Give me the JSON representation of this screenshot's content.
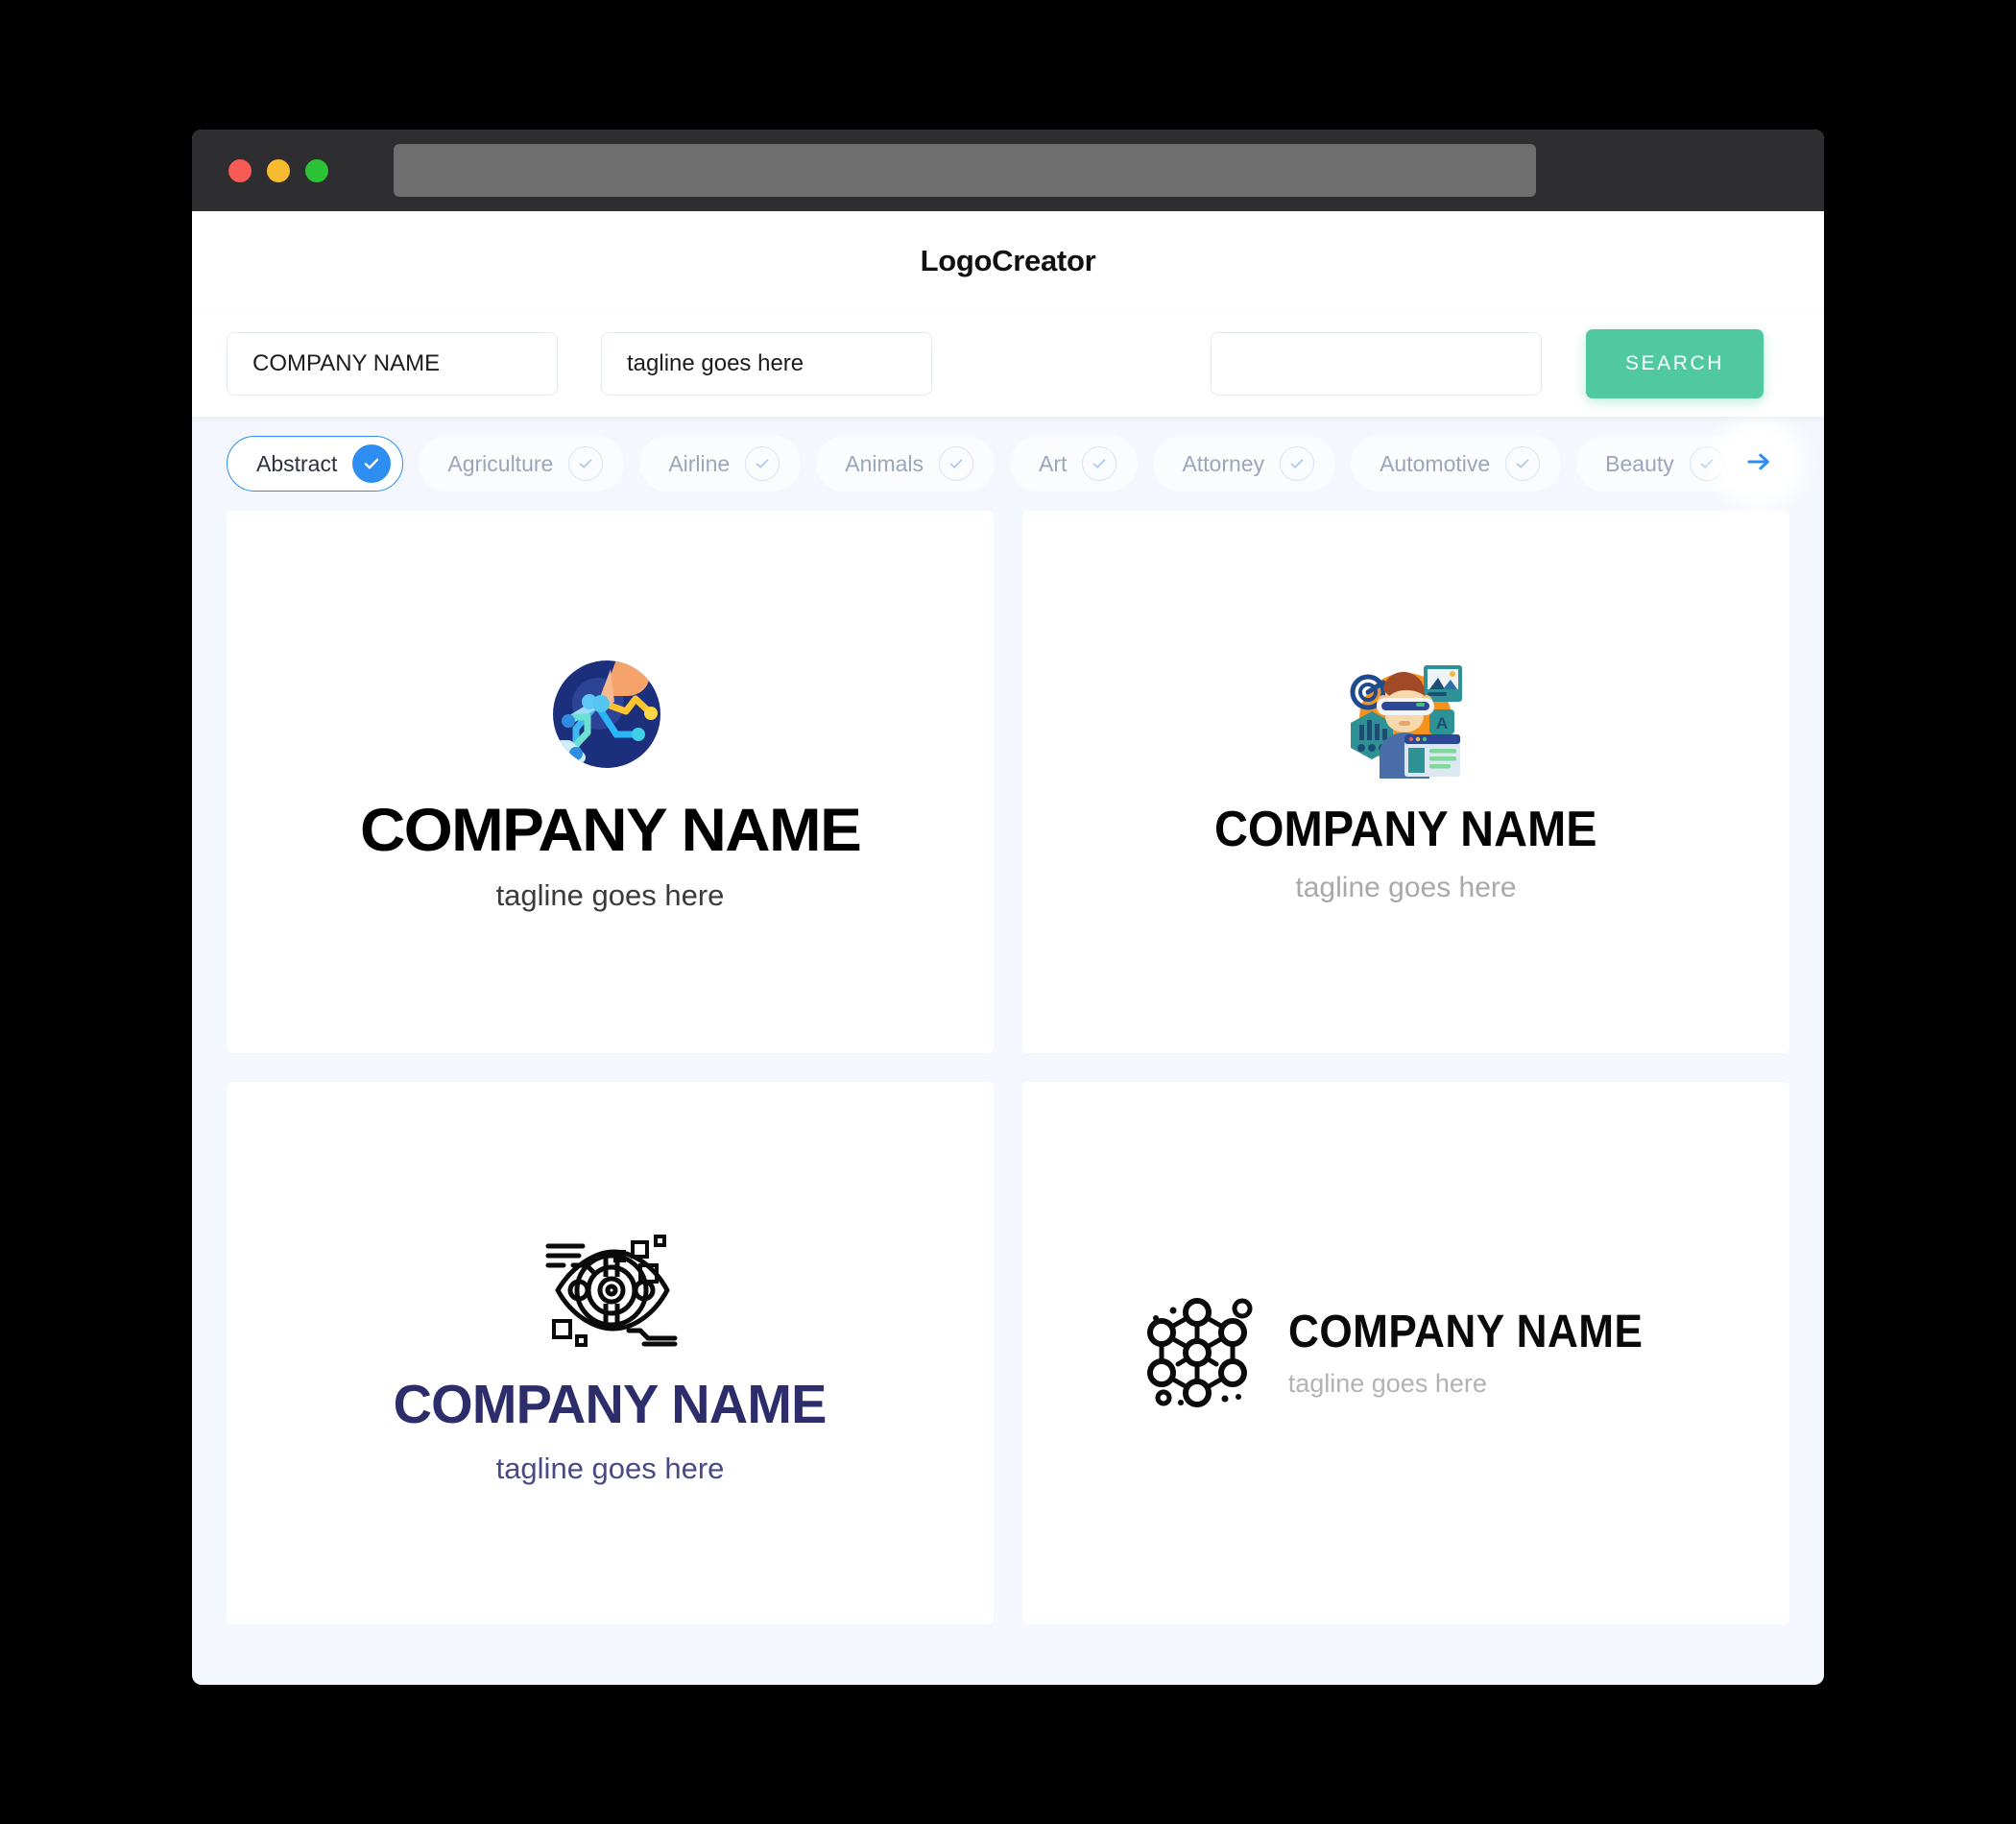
{
  "window": {
    "traffic_lights": [
      "close",
      "minimize",
      "maximize"
    ],
    "url_value": ""
  },
  "header": {
    "title": "LogoCreator"
  },
  "search": {
    "company_value": "COMPANY NAME",
    "tagline_value": "tagline goes here",
    "extra_value": "",
    "button_label": "SEARCH",
    "button_color": "#50c9a0"
  },
  "categories": {
    "items": [
      {
        "label": "Abstract",
        "selected": true
      },
      {
        "label": "Agriculture",
        "selected": false
      },
      {
        "label": "Airline",
        "selected": false
      },
      {
        "label": "Animals",
        "selected": false
      },
      {
        "label": "Art",
        "selected": false
      },
      {
        "label": "Attorney",
        "selected": false
      },
      {
        "label": "Automotive",
        "selected": false
      },
      {
        "label": "Beauty",
        "selected": false
      }
    ],
    "active_color": "#2e8df0",
    "next_label": "→"
  },
  "results": {
    "cards": [
      {
        "icon": "hand-touch-circuit-circle-icon",
        "company": "COMPANY NAME",
        "tagline": "tagline goes here",
        "text_color": "#000000",
        "tagline_color": "#3b3b3b"
      },
      {
        "icon": "vr-headset-person-icon",
        "company": "COMPANY NAME",
        "tagline": "tagline goes here",
        "text_color": "#050505",
        "tagline_color": "#a9a9a9"
      },
      {
        "icon": "tech-eye-icon",
        "company": "COMPANY NAME",
        "tagline": "tagline goes here",
        "text_color": "#2d2d6b",
        "tagline_color": "#4a4a86"
      },
      {
        "icon": "hexagon-network-nodes-icon",
        "company": "COMPANY NAME",
        "tagline": "tagline goes here",
        "text_color": "#0a0a0a",
        "tagline_color": "#b3b3b3"
      }
    ]
  }
}
